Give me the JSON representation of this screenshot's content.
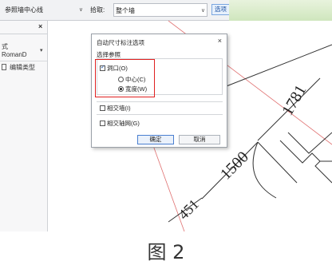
{
  "toolbar": {
    "reference_combo": "参照墙中心线",
    "pick_label": "拾取:",
    "pick_value": "整个墙",
    "options_button": "选项"
  },
  "properties_panel": {
    "close": "×",
    "type_line1": "式",
    "type_line2": "RomanD",
    "edit_type": "编辑类型"
  },
  "dialog": {
    "title": "自动尺寸标注选项",
    "close": "×",
    "section_label": "选择参照",
    "openings": "洞口(O)",
    "center": "中心(C)",
    "width": "宽度(W)",
    "intersecting_walls": "相交墙(I)",
    "intersecting_grids": "相交轴网(G)",
    "ok": "确定",
    "cancel": "取消"
  },
  "drawing": {
    "dim_1781": "1781",
    "dim_1500": "1500",
    "dim_451": "451"
  },
  "caption": "图 2",
  "colors": {
    "highlight_red": "#e02020",
    "accent_blue": "#4a7fd0",
    "toolbar_green": "#cfe6bd"
  }
}
